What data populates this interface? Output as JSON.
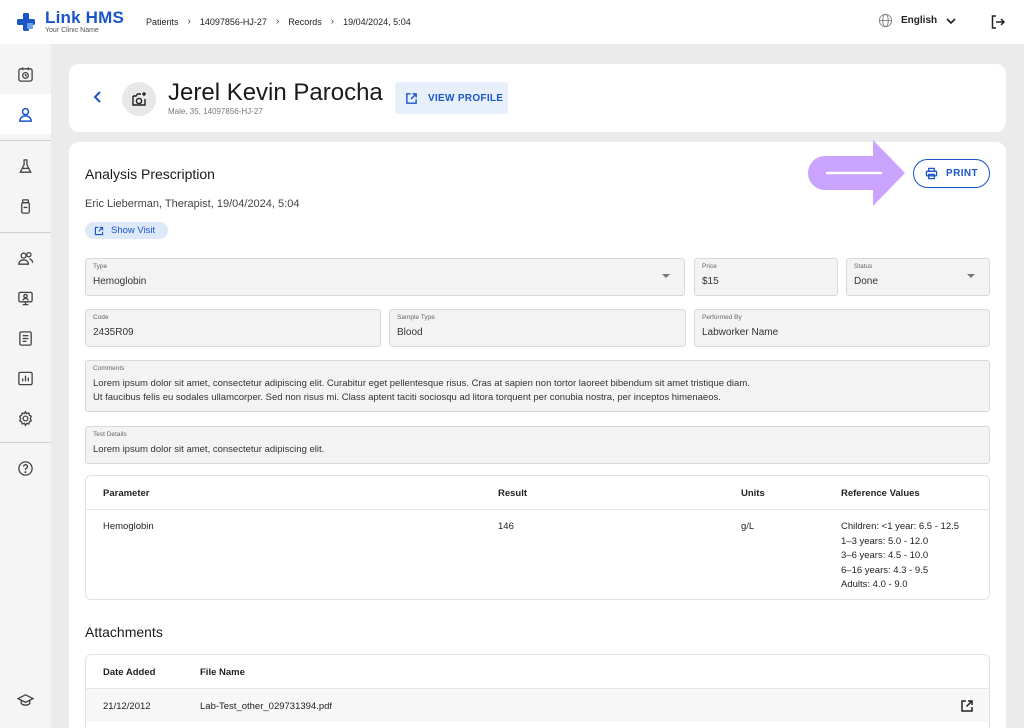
{
  "app": {
    "name": "Link HMS",
    "subtitle": "Your Clinic Name"
  },
  "breadcrumb": [
    "Patients",
    "14097856-HJ-27",
    "Records",
    "19/04/2024, 5:04"
  ],
  "header": {
    "language": "English"
  },
  "patient": {
    "name": "Jerel Kevin Parocha",
    "meta": "Male, 35, 14097856-HJ-27",
    "view_profile_label": "VIEW PROFILE"
  },
  "prescription": {
    "title": "Analysis Prescription",
    "prescribed_by": "Eric Lieberman, Therapist, 19/04/2024, 5:04",
    "show_visit_label": "Show Visit",
    "print_label": "PRINT"
  },
  "fields": {
    "type": {
      "label": "Type",
      "value": "Hemoglobin"
    },
    "price": {
      "label": "Price",
      "value": "$15"
    },
    "status": {
      "label": "Status",
      "value": "Done"
    },
    "code": {
      "label": "Code",
      "value": "2435R09"
    },
    "sample_type": {
      "label": "Sample Type",
      "value": "Blood"
    },
    "performed_by": {
      "label": "Performed By",
      "value": "Labworker Name"
    },
    "comments": {
      "label": "Comments",
      "line1": "Lorem ipsum dolor sit amet, consectetur adipiscing elit. Curabitur eget pellentesque risus. Cras at sapien non tortor laoreet bibendum sit amet tristique diam.",
      "line2": "Ut faucibus felis eu sodales ullamcorper. Sed non risus mi. Class aptent taciti sociosqu ad litora torquent per conubia nostra, per inceptos himenaeos."
    },
    "test_details": {
      "label": "Test Details",
      "value": "Lorem ipsum dolor sit amet, consectetur adipiscing elit."
    }
  },
  "results_table": {
    "headers": {
      "parameter": "Parameter",
      "result": "Result",
      "units": "Units",
      "reference": "Reference Values"
    },
    "row": {
      "parameter": "Hemoglobin",
      "result": "146",
      "units": "g/L",
      "reference": [
        "Children: <1 year: 6.5 - 12.5",
        "1–3 years: 5.0 - 12.0",
        "3–6 years: 4.5 - 10.0",
        "6–16 years: 4.3 - 9.5",
        "Adults: 4.0 - 9.0"
      ]
    }
  },
  "attachments": {
    "title": "Attachments",
    "headers": {
      "date_added": "Date Added",
      "file_name": "File Name"
    },
    "row": {
      "date_added": "21/12/2012",
      "file_name": "Lab-Test_other_029731394.pdf"
    }
  },
  "colors": {
    "accent": "#1a56c8",
    "annotation": "#c9a3ff"
  }
}
